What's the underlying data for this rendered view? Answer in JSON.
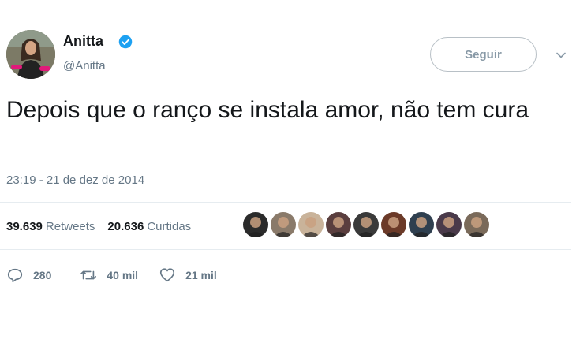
{
  "user": {
    "display_name": "Anitta",
    "handle": "@Anitta",
    "verified": true,
    "verified_color": "#1da1f2"
  },
  "follow_button": {
    "label": "Seguir"
  },
  "menu": {
    "icon": "chevron-down-icon"
  },
  "tweet": {
    "text": "Depois que o ranço se instala amor, não tem cura",
    "timestamp": "23:19 - 21 de dez de 2014"
  },
  "stats": {
    "retweets_count": "39.639",
    "retweets_label": "Retweets",
    "likes_count": "20.636",
    "likes_label": "Curtidas"
  },
  "likers": [
    {
      "color": "#2b2b2b"
    },
    {
      "color": "#8a7a6a"
    },
    {
      "color": "#c9b39a"
    },
    {
      "color": "#5a3e3e"
    },
    {
      "color": "#3a3a3a"
    },
    {
      "color": "#6b3a28"
    },
    {
      "color": "#2f3f4f"
    },
    {
      "color": "#4a3a4a"
    },
    {
      "color": "#7a6a5a"
    }
  ],
  "actions": {
    "replies": "280",
    "retweets": "40 mil",
    "likes": "21 mil"
  },
  "colors": {
    "text": "#14171a",
    "secondary": "#657786",
    "divider": "#e6ecf0",
    "accent": "#1da1f2"
  }
}
